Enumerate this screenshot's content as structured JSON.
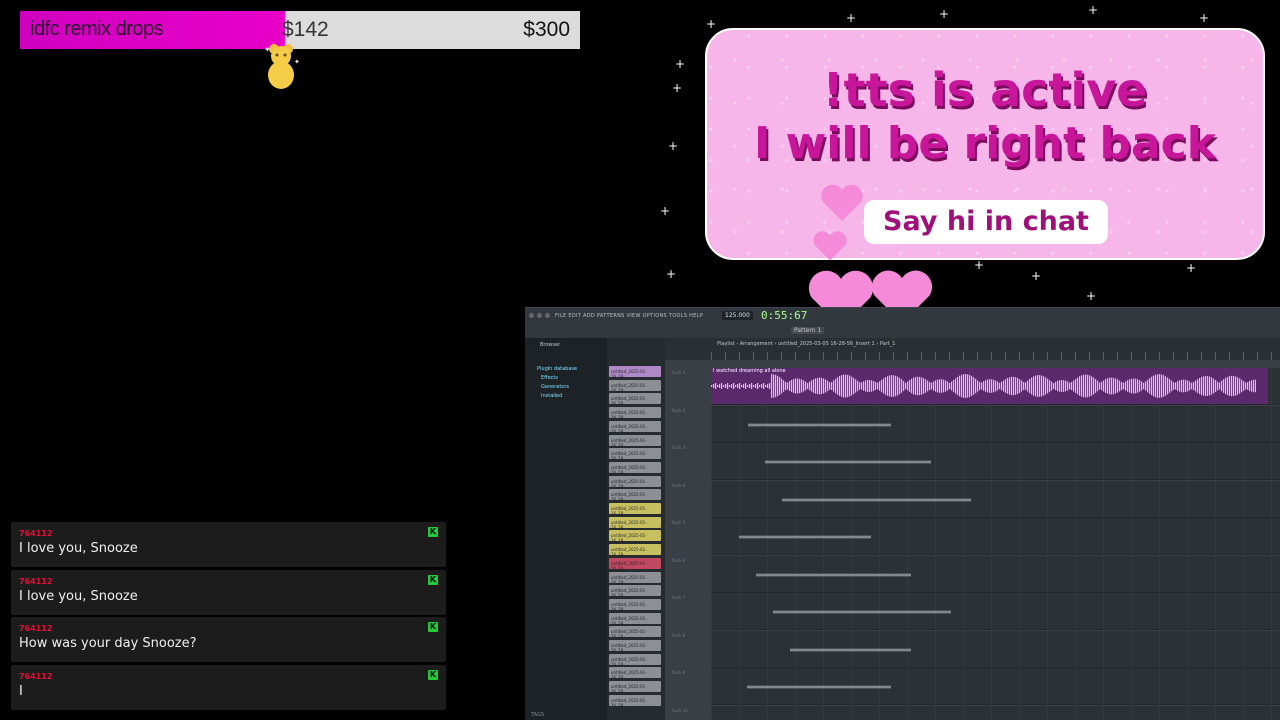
{
  "goal": {
    "title": "idfc remix drops",
    "current": "$142",
    "target": "$300",
    "progress": 0.473
  },
  "brb": {
    "line1": "!tts is active",
    "line2": "I will be right back",
    "pill": "Say hi in chat",
    "colors": {
      "card": "#f7b6ea",
      "text": "#c8169a",
      "heart": "#f48ad8"
    }
  },
  "chat": [
    {
      "user": "764112",
      "message": "I love you, Snooze",
      "badge": "K"
    },
    {
      "user": "764112",
      "message": "I love you, Snooze",
      "badge": "K"
    },
    {
      "user": "764112",
      "message": "How was your day Snooze?",
      "badge": "K"
    },
    {
      "user": "764112",
      "message": "I",
      "badge": "K"
    }
  ],
  "daw": {
    "menu": "FILE EDIT ADD PATTERNS VIEW OPTIONS TOOLS HELP",
    "tempo": "125.000",
    "time": "0:55:67",
    "pattern": "Pattern 1",
    "browser": {
      "title": "Browser",
      "items": [
        "Plugin database",
        "Effects",
        "Generators",
        "Installed"
      ],
      "search": "TAGS"
    },
    "channels": [
      "untitled_2025-01-16_18...",
      "untitled_2025-01-16_18...",
      "untitled_2025-01-16_18...",
      "untitled_2025-01-16_18...",
      "untitled_2025-01-16_18...",
      "untitled_2025-01-16_18...",
      "untitled_2025-01-16_18...",
      "untitled_2025-01-16_18...",
      "untitled_2025-01-16_18...",
      "untitled_2025-01-16_18...",
      "untitled_2025-01-16_18...",
      "untitled_2025-01-16_18...",
      "untitled_2025-01-16_18...",
      "untitled_2025-01-16_18...",
      "untitled_2025-01-16_18...",
      "untitled_2025-01-16_18...",
      "untitled_2025-01-16_18...",
      "untitled_2025-01-16_18...",
      "untitled_2025-01-16_18...",
      "untitled_2025-01-16_18...",
      "untitled_2025-01-16_18...",
      "untitled_2025-01-16_18...",
      "untitled_2025-01-16_18...",
      "untitled_2025-01-16_18...",
      "untitled_2025-01-16_18..."
    ],
    "playlist": {
      "title": "Playlist - Arrangement › untitled_2025-03-05 16-28-56_Insert 1 › Part_1",
      "main_clip": "I watched dreaming all alone",
      "tracks": [
        "Track 1",
        "Track 2",
        "Track 3",
        "Track 4",
        "Track 5",
        "Track 6",
        "Track 7",
        "Track 8",
        "Track 9",
        "Track 10"
      ]
    }
  }
}
